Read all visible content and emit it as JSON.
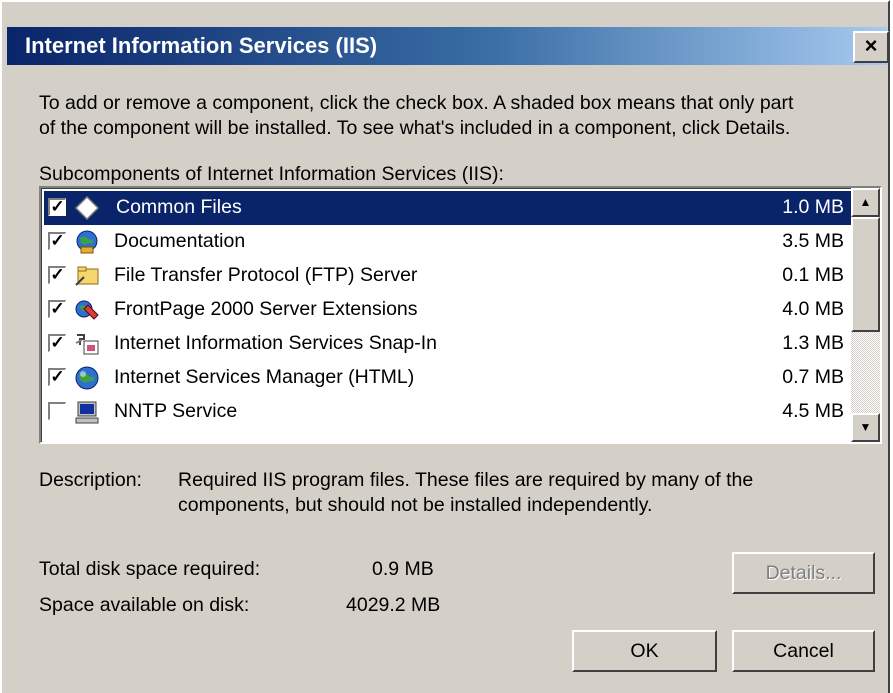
{
  "window": {
    "title": "Internet Information Services (IIS)",
    "close_label": "×"
  },
  "instructions": {
    "line1": "To add or remove a component, click the check box. A shaded box means that only part",
    "line2": "of the component will be installed. To see what's included in a component, click Details."
  },
  "list": {
    "label": "Subcomponents of Internet Information Services (IIS):",
    "items": [
      {
        "label": "Common Files",
        "size": "1.0 MB",
        "checked": true,
        "icon": "diamond-icon",
        "selected": true
      },
      {
        "label": "Documentation",
        "size": "3.5 MB",
        "checked": true,
        "icon": "globe-book-icon"
      },
      {
        "label": "File Transfer Protocol (FTP) Server",
        "size": "0.1 MB",
        "checked": true,
        "icon": "folder-icon"
      },
      {
        "label": "FrontPage 2000 Server Extensions",
        "size": "4.0 MB",
        "checked": true,
        "icon": "frontpage-icon"
      },
      {
        "label": "Internet Information Services Snap-In",
        "size": "1.3 MB",
        "checked": true,
        "icon": "snap-in-icon"
      },
      {
        "label": "Internet Services Manager (HTML)",
        "size": "0.7 MB",
        "checked": true,
        "icon": "globe-icon"
      },
      {
        "label": "NNTP Service",
        "size": "4.5 MB",
        "checked": false,
        "icon": "computer-icon"
      }
    ]
  },
  "description": {
    "label": "Description:",
    "line1": "Required IIS program files. These files are required by many of the",
    "line2": "components, but should not be installed independently."
  },
  "disk": {
    "required_label": "Total disk space required:",
    "required_value": "0.9 MB",
    "available_label": "Space available on disk:",
    "available_value": "4029.2 MB"
  },
  "buttons": {
    "details": "Details...",
    "ok": "OK",
    "cancel": "Cancel"
  },
  "colors": {
    "title_start": "#0a246a",
    "title_end": "#a6caf0",
    "selection": "#0a246a",
    "face": "#d4d0c8"
  }
}
